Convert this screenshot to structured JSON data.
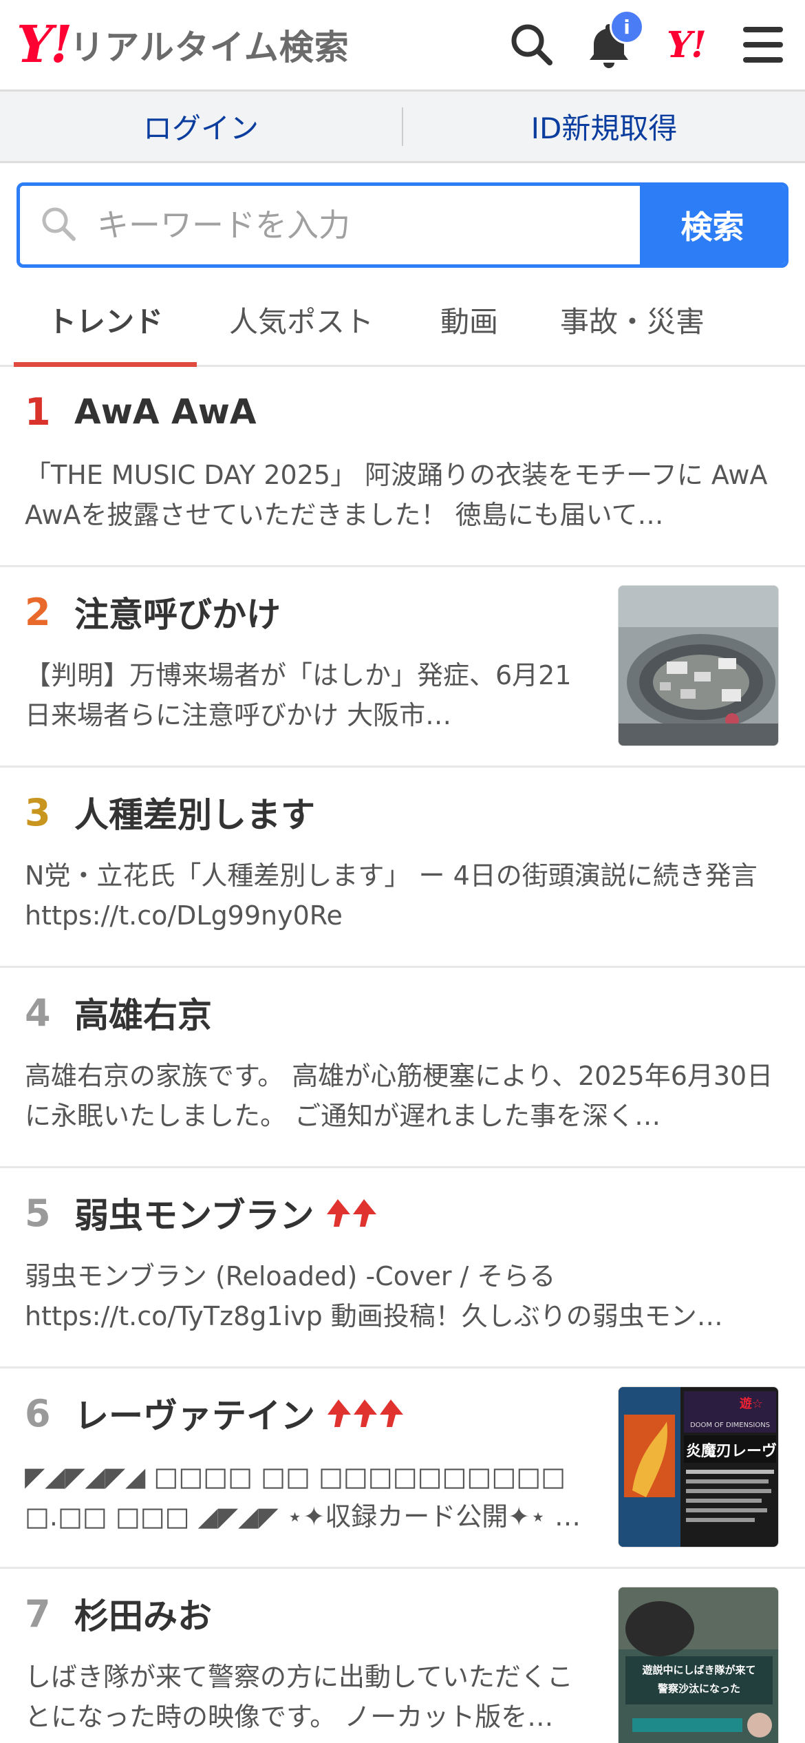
{
  "header": {
    "logo_mark": "Y!",
    "logo_text": "リアルタイム検索",
    "badge": "i",
    "yj_logo": "Y!"
  },
  "login": {
    "login_label": "ログイン",
    "signup_label": "ID新規取得"
  },
  "search": {
    "placeholder": "キーワードを入力",
    "button": "検索"
  },
  "tabs": [
    {
      "label": "トレンド",
      "active": true
    },
    {
      "label": "人気ポスト"
    },
    {
      "label": "動画"
    },
    {
      "label": "事故・災害"
    }
  ],
  "colors": {
    "accent_blue": "#2d7df6",
    "brand_red": "#ff0033",
    "tab_underline": "#e04a3f"
  },
  "trends": [
    {
      "rank": "1",
      "rank_color": "#d8322a",
      "title": "AwA AwA",
      "desc": "「THE MUSIC DAY 2025」 阿波踊りの衣装をモチーフに AwA AwAを披露させていただきました！ 徳島にも届いて…"
    },
    {
      "rank": "2",
      "rank_color": "#e8692a",
      "title": "注意呼びかけ",
      "desc": "【判明】万博来場者が「はしか」発症、6月21日来場者らに注意呼びかけ 大阪市…"
    },
    {
      "rank": "3",
      "rank_color": "#c8961e",
      "title": "人種差別します",
      "desc": "N党・立花氏「人種差別します」 ー 4日の街頭演説に続き発言 https://t.co/DLg99ny0Re"
    },
    {
      "rank": "4",
      "rank_color": "#9a9a9a",
      "title": "高雄右京",
      "desc": "高雄右京の家族です。 高雄が心筋梗塞により、2025年6月30日に永眠いたしました。 ご通知が遅れました事を深く…"
    },
    {
      "rank": "5",
      "rank_color": "#9a9a9a",
      "title": "弱虫モンブラン",
      "desc": "弱虫モンブラン (Reloaded) -Cover / そらる https://t.co/TyTz8g1ivp 動画投稿！久しぶりの弱虫モン…"
    },
    {
      "rank": "6",
      "rank_color": "#9a9a9a",
      "title": "レーヴァテイン",
      "desc": "◤◢◤◢◤◢ □□□□ □□ □□□□□□□□□□ □.□□ □□□ ◢◤◢◤ ⋆✦収録カード公開✦⋆ ◤炎魔刃レーヴ…"
    },
    {
      "rank": "7",
      "rank_color": "#9a9a9a",
      "title": "杉田みお",
      "desc": "しばき隊が来て警察の方に出動していただくことになった時の映像です。 ノーカット版を…"
    }
  ],
  "thumbnails": {
    "item6_card_title": "炎魔刃レーヴァ",
    "item6_banner": "DOOM OF DIMENSIONS",
    "item7_caption_1": "遊説中にしばき隊が来て",
    "item7_caption_2": "警察沙汰になった"
  }
}
